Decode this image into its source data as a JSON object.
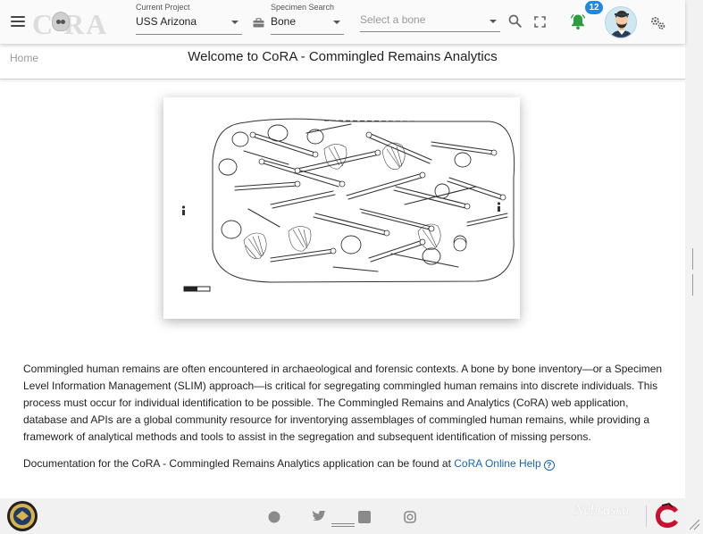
{
  "app": {
    "logo_text": "C RA"
  },
  "toolbar": {
    "current_project": {
      "label": "Current Project",
      "value": "USS Arizona"
    },
    "specimen_search": {
      "label": "Specimen Search",
      "value": "Bone"
    },
    "bone_select": {
      "placeholder": "Select a bone"
    },
    "notification_count": "12",
    "icons": [
      "menu-icon",
      "briefcase-icon",
      "search-icon",
      "fullscreen-icon",
      "bell-icon",
      "settings-icon"
    ],
    "colors": {
      "bell": "#2e9c3f",
      "badge": "#1e88e5"
    }
  },
  "header": {
    "breadcrumb": "Home",
    "title": "Welcome to CoRA - Commingled Remains Analytics"
  },
  "main": {
    "intro": "Commingled human remains are often encountered in archaeological and forensic contexts. A bone by bone inventory—or a Specimen Level Information Management (SLIM) approach—is critical for segregating commingled human remains into discrete individuals. This process must occur for individual identification to be possible. The Commingled Remains and Analytics (CoRA) web application, database and APIs are a global community resource for inventorying assemblages of commingled human remains, while providing a framework of analytical methods and tools to assist in the segregation and subsequent identification of missing persons.",
    "doc_prefix": "Documentation for the CoRA - Commingled Remains Analytics application can be found at ",
    "doc_link": "CoRA Online Help",
    "link_color": "#1565c0"
  },
  "footer": {
    "partner_text": "Nebraska",
    "icons": [
      "seal-logo",
      "facebook-icon",
      "twitter-icon",
      "linkedin-icon",
      "instagram-icon",
      "partner-logo"
    ]
  }
}
